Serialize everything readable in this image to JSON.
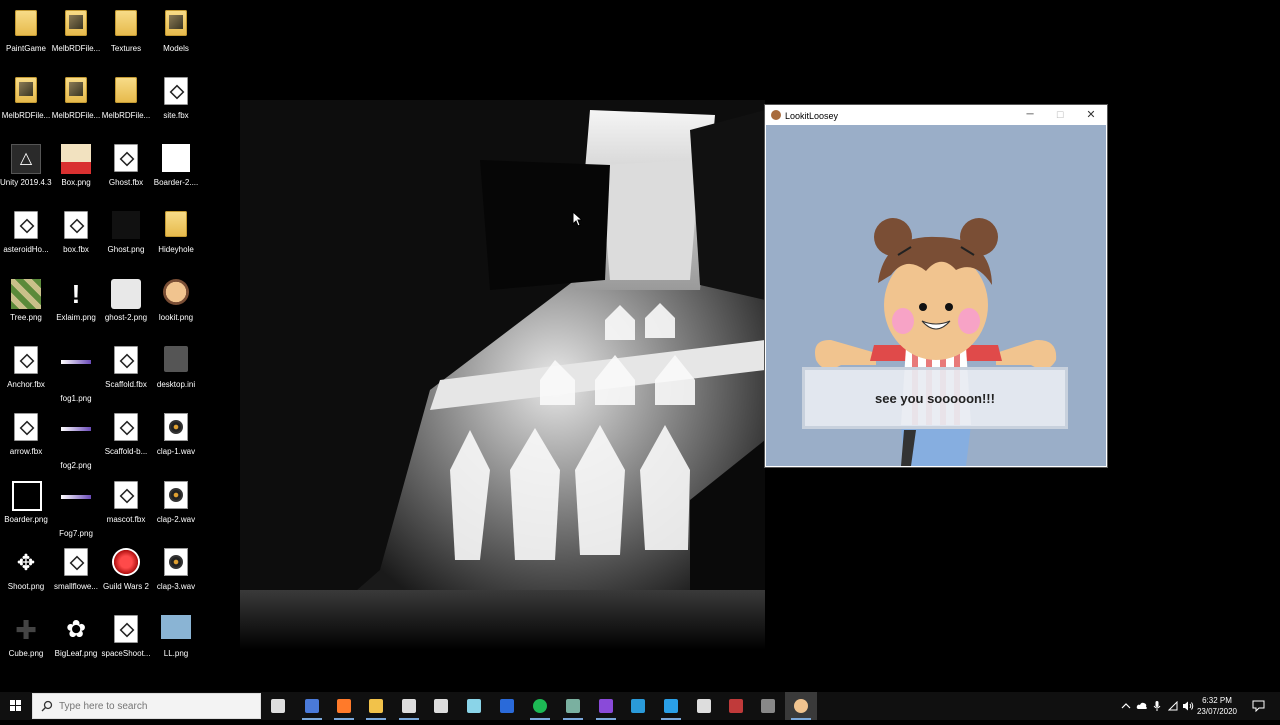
{
  "desktop": {
    "icons": [
      {
        "label": "PaintGame",
        "type": "folder",
        "col": 0,
        "row": 0
      },
      {
        "label": "MelbRDFile...",
        "type": "folder-pic",
        "col": 1,
        "row": 0
      },
      {
        "label": "Textures",
        "type": "folder",
        "col": 2,
        "row": 0
      },
      {
        "label": "Models",
        "type": "folder-pic",
        "col": 3,
        "row": 0
      },
      {
        "label": "MelbRDFile...",
        "type": "folder-pic",
        "col": 0,
        "row": 1
      },
      {
        "label": "MelbRDFile...",
        "type": "folder-pic",
        "col": 1,
        "row": 1
      },
      {
        "label": "MelbRDFile...",
        "type": "folder",
        "col": 2,
        "row": 1
      },
      {
        "label": "site.fbx",
        "type": "fbx",
        "col": 3,
        "row": 1
      },
      {
        "label": "Unity 2019.4.3...",
        "type": "unity",
        "col": 0,
        "row": 2
      },
      {
        "label": "Box.png",
        "type": "box-png",
        "col": 1,
        "row": 2
      },
      {
        "label": "Ghost.fbx",
        "type": "fbx",
        "col": 2,
        "row": 2
      },
      {
        "label": "Boarder-2....",
        "type": "white-png",
        "col": 3,
        "row": 2
      },
      {
        "label": "asteroidHo...",
        "type": "fbx",
        "col": 0,
        "row": 3
      },
      {
        "label": "box.fbx",
        "type": "fbx",
        "col": 1,
        "row": 3
      },
      {
        "label": "Ghost.png",
        "type": "black-png",
        "col": 2,
        "row": 3
      },
      {
        "label": "Hideyhole",
        "type": "folder",
        "col": 3,
        "row": 3
      },
      {
        "label": "Tree.png",
        "type": "tree-png",
        "col": 0,
        "row": 4
      },
      {
        "label": "Exlaim.png",
        "type": "exclaim-png",
        "col": 1,
        "row": 4
      },
      {
        "label": "ghost-2.png",
        "type": "ghost2-png",
        "col": 2,
        "row": 4
      },
      {
        "label": "lookit.png",
        "type": "lookit-png",
        "col": 3,
        "row": 4
      },
      {
        "label": "Anchor.fbx",
        "type": "fbx",
        "col": 0,
        "row": 5
      },
      {
        "label": "fog1.png",
        "type": "fog-png",
        "col": 1,
        "row": 5
      },
      {
        "label": "Scaffold.fbx",
        "type": "fbx",
        "col": 2,
        "row": 5
      },
      {
        "label": "desktop.ini",
        "type": "ini",
        "col": 3,
        "row": 5
      },
      {
        "label": "arrow.fbx",
        "type": "fbx",
        "col": 0,
        "row": 6
      },
      {
        "label": "fog2.png",
        "type": "fog-png",
        "col": 1,
        "row": 6
      },
      {
        "label": "Scaffold-b...",
        "type": "fbx",
        "col": 2,
        "row": 6
      },
      {
        "label": "clap-1.wav",
        "type": "wav",
        "col": 3,
        "row": 6
      },
      {
        "label": "Boarder.png",
        "type": "border-png",
        "col": 0,
        "row": 7
      },
      {
        "label": "Fog7.png",
        "type": "fog-png",
        "col": 1,
        "row": 7
      },
      {
        "label": "mascot.fbx",
        "type": "fbx",
        "col": 2,
        "row": 7
      },
      {
        "label": "clap-2.wav",
        "type": "wav",
        "col": 3,
        "row": 7
      },
      {
        "label": "Shoot.png",
        "type": "crosshair-png",
        "col": 0,
        "row": 8
      },
      {
        "label": "smallflowe...",
        "type": "fbx",
        "col": 1,
        "row": 8
      },
      {
        "label": "Guild Wars 2",
        "type": "gw2",
        "col": 2,
        "row": 8
      },
      {
        "label": "clap-3.wav",
        "type": "wav",
        "col": 3,
        "row": 8
      },
      {
        "label": "Cube.png",
        "type": "cube-png",
        "col": 0,
        "row": 9
      },
      {
        "label": "BigLeaf.png",
        "type": "leaf-png",
        "col": 1,
        "row": 9
      },
      {
        "label": "spaceShoot...",
        "type": "fbx",
        "col": 2,
        "row": 9
      },
      {
        "label": "LL.png",
        "type": "ll-png",
        "col": 3,
        "row": 9
      }
    ]
  },
  "app_window": {
    "title": "LookitLoosey",
    "minimize_glyph": "─",
    "maximize_glyph": "☐",
    "close_glyph": "✕",
    "speech_text": "see you sooooon!!!",
    "colors": {
      "background": "#9aaec8",
      "skin": "#f1c48f",
      "hair": "#7a4e35",
      "shirt": "#e04a4a",
      "cheek": "#f7a3c6"
    }
  },
  "taskbar": {
    "search_placeholder": "Type here to search",
    "apps": [
      "task-view-icon",
      "outlook-icon",
      "firefox-icon",
      "file-explorer-icon",
      "unity-icon",
      "unity-hub-icon",
      "notepad-icon",
      "maps-icon",
      "spotify-icon",
      "image-viewer-icon",
      "visual-studio-icon",
      "app-icon",
      "app-icon-2",
      "unity-icon-2",
      "game-icon",
      "obs-icon",
      "lookitloosey-icon"
    ],
    "clock_time": "6:32 PM",
    "clock_date": "23/07/2020"
  }
}
